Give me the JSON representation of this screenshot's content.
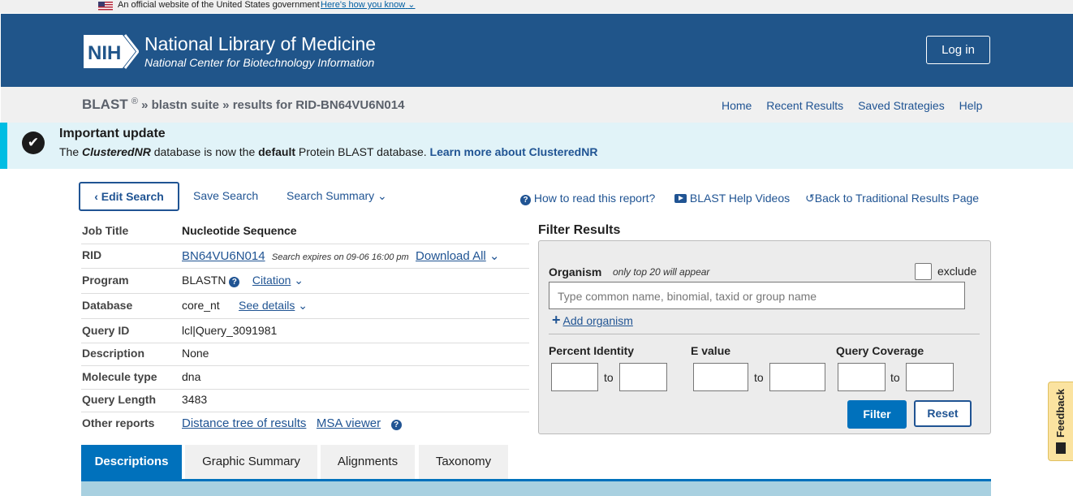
{
  "gov_banner": {
    "text": "An official website of the United States government",
    "link": "Here's how you know"
  },
  "header": {
    "logo_text": "NIH",
    "title": "National Library of Medicine",
    "subtitle": "National Center for Biotechnology Information",
    "login_label": "Log in"
  },
  "breadcrumb": {
    "root": "BLAST",
    "reg": "®",
    "sep": "»",
    "suite": "blastn suite",
    "current": "results for RID-BN64VU6N014"
  },
  "top_nav": [
    "Home",
    "Recent Results",
    "Saved Strategies",
    "Help"
  ],
  "update_banner": {
    "heading": "Important update",
    "text_1": "The ",
    "db_name": "ClusteredNR",
    "text_2": " database is now the ",
    "text_bold": "default",
    "text_3": " Protein BLAST database. ",
    "link": "Learn more about ClusteredNR"
  },
  "actions": {
    "edit_search": "Edit Search",
    "save_search": "Save Search",
    "search_summary": "Search Summary",
    "how_to_read": "How to read this report?",
    "help_videos": "BLAST Help Videos",
    "back_traditional": "Back to Traditional Results Page"
  },
  "job": {
    "job_title_label": "Job Title",
    "job_title": "Nucleotide Sequence",
    "rid_label": "RID",
    "rid": "BN64VU6N014",
    "expires": "Search expires on 09-06 16:00 pm",
    "download_all": "Download All",
    "program_label": "Program",
    "program": "BLASTN",
    "citation": "Citation",
    "database_label": "Database",
    "database": "core_nt",
    "see_details": "See details",
    "query_id_label": "Query ID",
    "query_id": "lcl|Query_3091981",
    "description_label": "Description",
    "description": "None",
    "molecule_type_label": "Molecule type",
    "molecule_type": "dna",
    "query_length_label": "Query Length",
    "query_length": "3483",
    "other_reports_label": "Other reports",
    "distance_tree": "Distance tree of results",
    "msa_viewer": "MSA viewer"
  },
  "filter": {
    "title": "Filter Results",
    "organism_label": "Organism",
    "organism_note": "only top 20 will appear",
    "exclude_label": "exclude",
    "organism_placeholder": "Type common  name, binomial, taxid or group  name",
    "add_organism": "Add organism",
    "percent_identity_label": "Percent Identity",
    "evalue_label": "E value",
    "query_coverage_label": "Query Coverage",
    "to": "to",
    "filter_button": "Filter",
    "reset_button": "Reset"
  },
  "tabs": [
    "Descriptions",
    "Graphic Summary",
    "Alignments",
    "Taxonomy"
  ],
  "feedback": "Feedback",
  "colors": {
    "header_bg": "#20558a",
    "link": "#205493",
    "primary_button": "#0071bc",
    "update_bg": "#e1f3f8",
    "update_accent": "#00bde3"
  }
}
